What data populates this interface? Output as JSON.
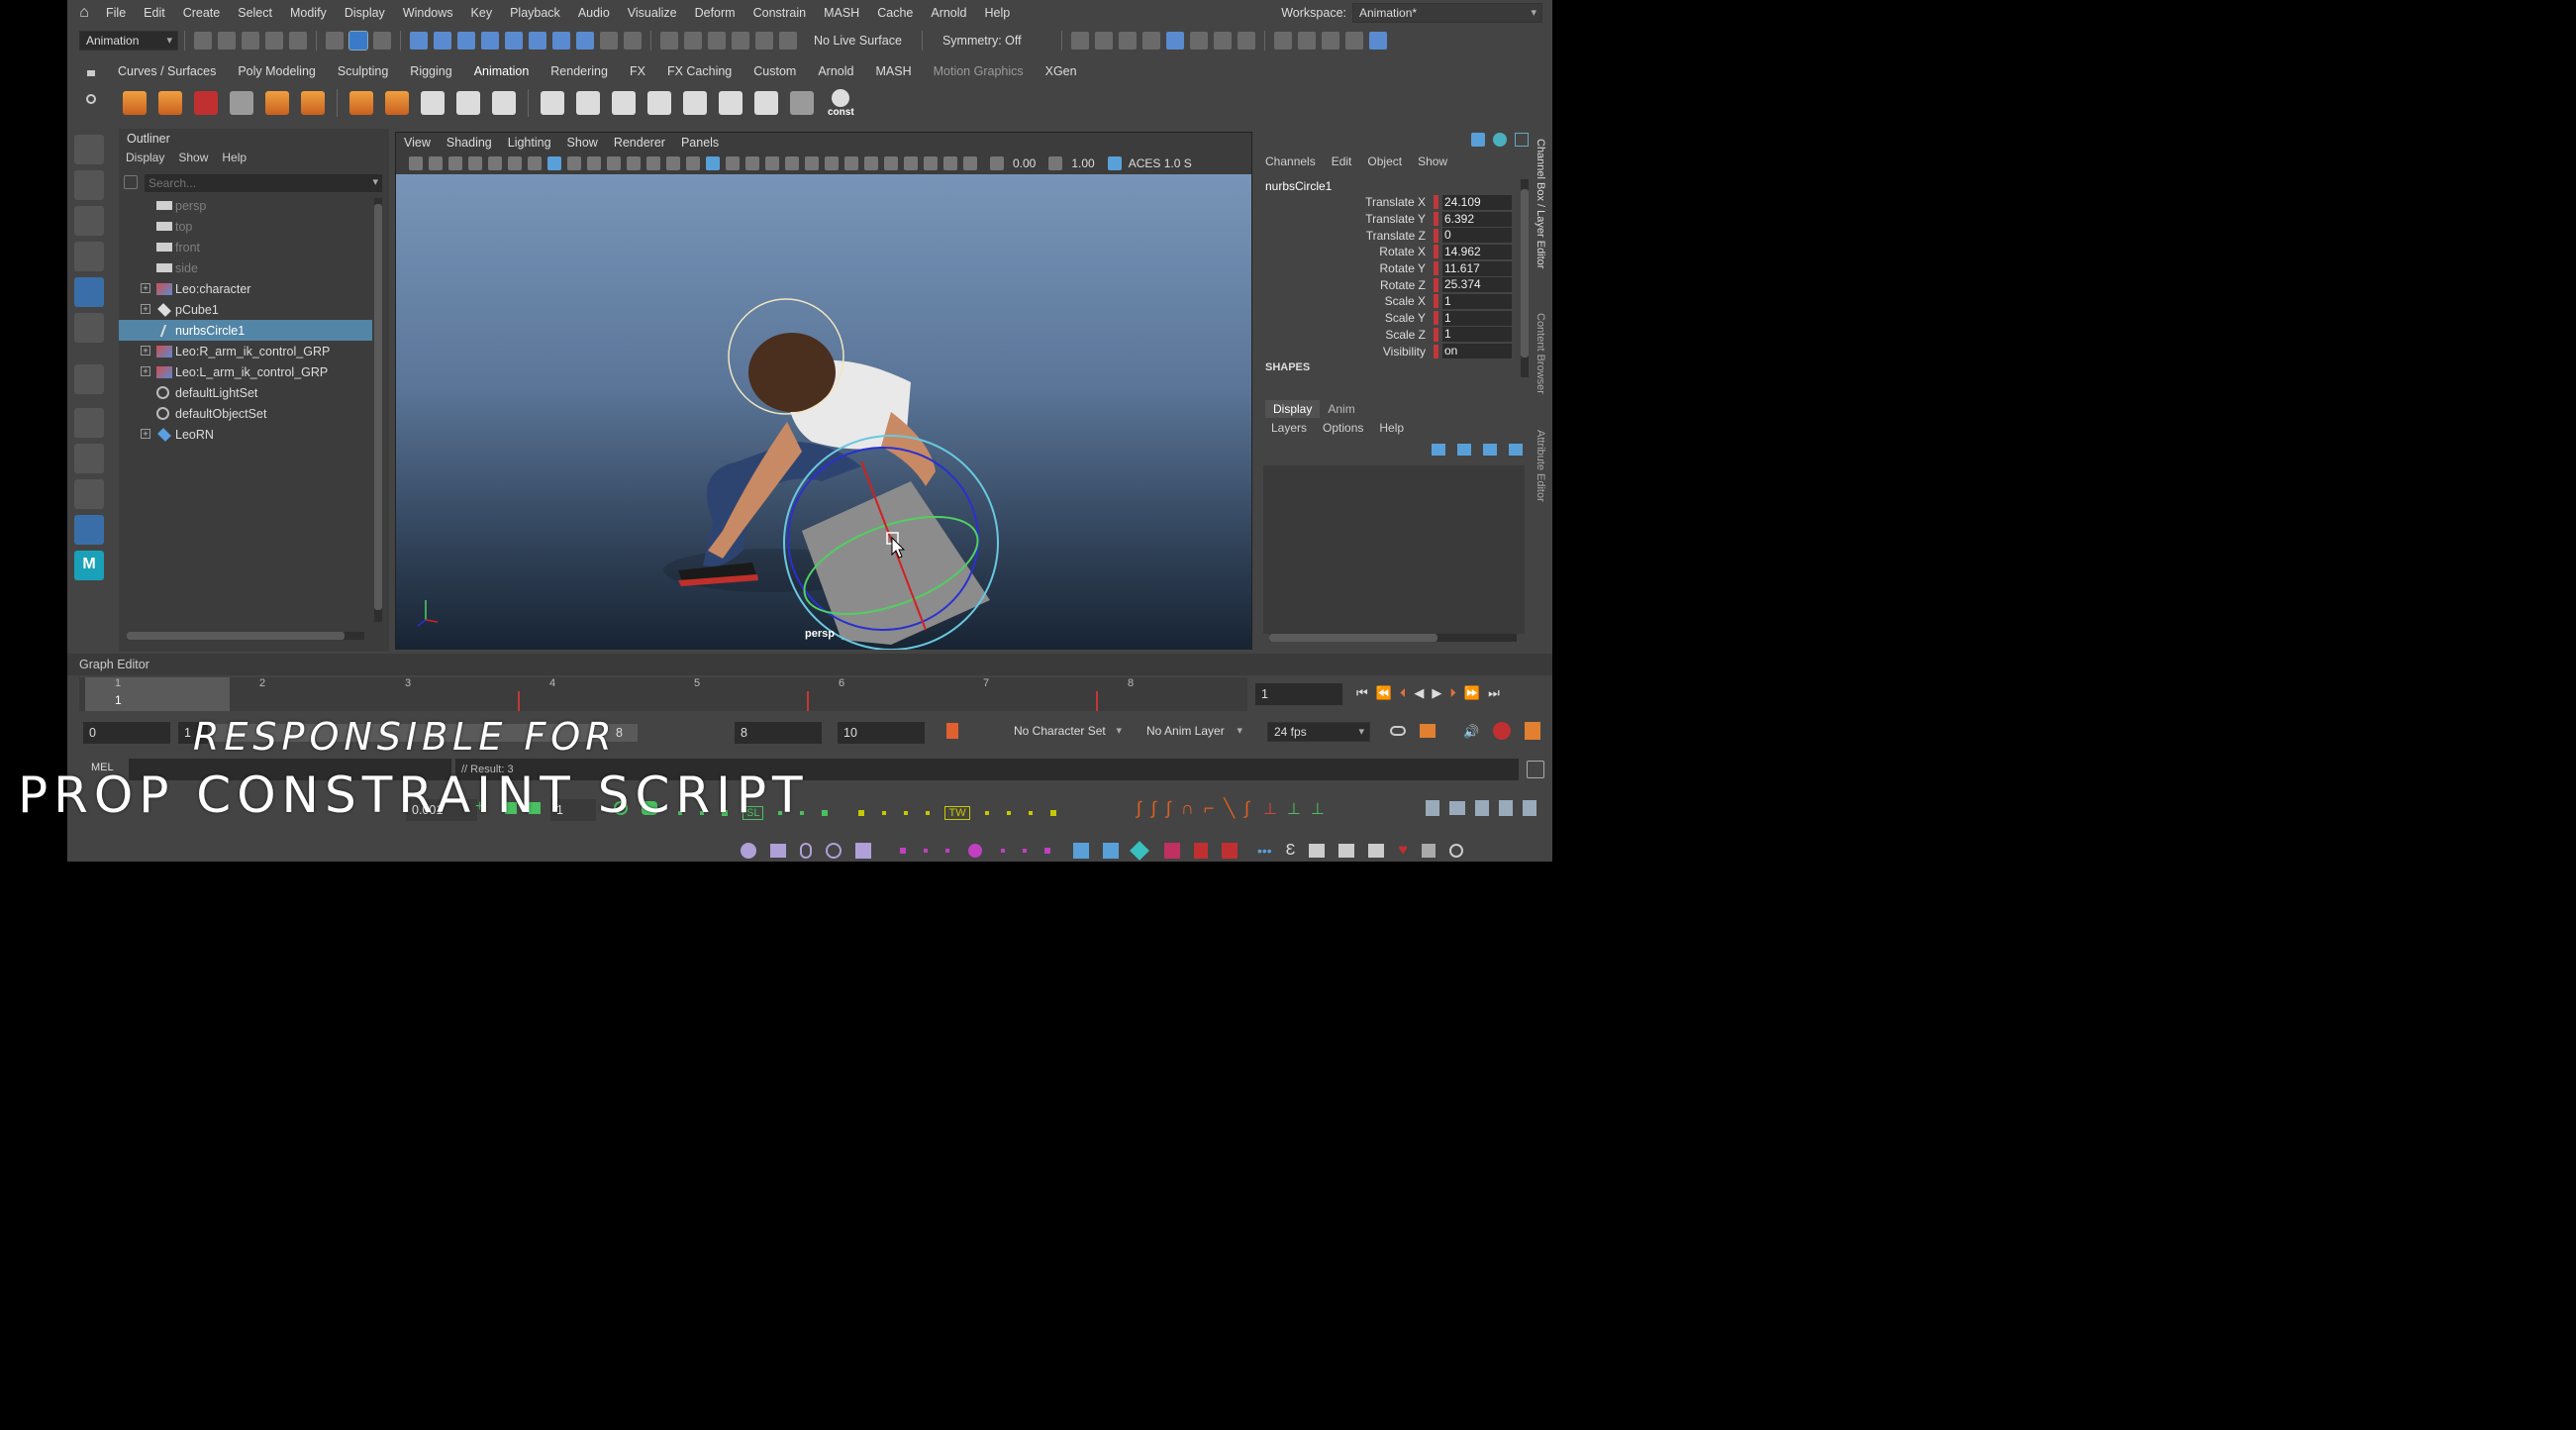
{
  "menubar": {
    "items": [
      "File",
      "Edit",
      "Create",
      "Select",
      "Modify",
      "Display",
      "Windows",
      "Key",
      "Playback",
      "Audio",
      "Visualize",
      "Deform",
      "Constrain",
      "MASH",
      "Cache",
      "Arnold",
      "Help"
    ],
    "workspace_label": "Workspace:",
    "workspace_value": "Animation*"
  },
  "toolbar": {
    "mode": "Animation",
    "live_surface": "No Live Surface",
    "symmetry": "Symmetry: Off"
  },
  "shelf": {
    "tabs": [
      "Curves / Surfaces",
      "Poly Modeling",
      "Sculpting",
      "Rigging",
      "Animation",
      "Rendering",
      "FX",
      "FX Caching",
      "Custom",
      "Arnold",
      "MASH",
      "Motion Graphics",
      "XGen"
    ],
    "const_label": "const"
  },
  "outliner": {
    "title": "Outliner",
    "menu": [
      "Display",
      "Show",
      "Help"
    ],
    "search_placeholder": "Search...",
    "items": [
      {
        "label": "persp"
      },
      {
        "label": "top"
      },
      {
        "label": "front"
      },
      {
        "label": "side"
      },
      {
        "label": "Leo:character"
      },
      {
        "label": "pCube1"
      },
      {
        "label": "nurbsCircle1"
      },
      {
        "label": "Leo:R_arm_ik_control_GRP"
      },
      {
        "label": "Leo:L_arm_ik_control_GRP"
      },
      {
        "label": "defaultLightSet"
      },
      {
        "label": "defaultObjectSet"
      },
      {
        "label": "LeoRN"
      }
    ]
  },
  "viewport": {
    "menu": [
      "View",
      "Shading",
      "Lighting",
      "Show",
      "Renderer",
      "Panels"
    ],
    "exposure": "0.00",
    "gamma": "1.00",
    "color_space": "ACES 1.0 S",
    "camera_label": "persp"
  },
  "channel_box": {
    "menu": [
      "Channels",
      "Edit",
      "Object",
      "Show"
    ],
    "object": "nurbsCircle1",
    "attrs": [
      {
        "name": "Translate X",
        "value": "24.109"
      },
      {
        "name": "Translate Y",
        "value": "6.392"
      },
      {
        "name": "Translate Z",
        "value": "0"
      },
      {
        "name": "Rotate X",
        "value": "14.962"
      },
      {
        "name": "Rotate Y",
        "value": "11.617"
      },
      {
        "name": "Rotate Z",
        "value": "25.374"
      },
      {
        "name": "Scale X",
        "value": "1"
      },
      {
        "name": "Scale Y",
        "value": "1"
      },
      {
        "name": "Scale Z",
        "value": "1"
      },
      {
        "name": "Visibility",
        "value": "on"
      }
    ],
    "shapes_label": "SHAPES",
    "side_tabs": [
      "Channel Box / Layer Editor",
      "Content Browser",
      "Attribute Editor"
    ]
  },
  "layer_editor": {
    "tabs": [
      "Display",
      "Anim"
    ],
    "menu": [
      "Layers",
      "Options",
      "Help"
    ]
  },
  "graph_editor_label": "Graph Editor",
  "timeline": {
    "ticks": [
      "1",
      "2",
      "3",
      "4",
      "5",
      "6",
      "7",
      "8"
    ],
    "current_marker": "1",
    "current_frame": "1"
  },
  "range": {
    "start": "0",
    "inner_start": "1",
    "inner_end": "8",
    "end": "8",
    "anim_end": "10",
    "character_set": "No Character Set",
    "anim_layer": "No Anim Layer",
    "fps": "24 fps"
  },
  "command_line": {
    "lang": "MEL",
    "result": "// Result: 3"
  },
  "bottom_shelf": {
    "field_value": "0.001",
    "frame_value": "1",
    "sl_label": "SL",
    "tw_label": "TW"
  },
  "caption": {
    "line1": "RESPONSIBLE FOR",
    "line2": "PROP CONSTRAINT SCRIPT"
  },
  "colors": {
    "selection": "#5285a6",
    "keyed_attr": "#c23838",
    "viewport_top": "#7895b8",
    "viewport_bottom": "#182433"
  }
}
